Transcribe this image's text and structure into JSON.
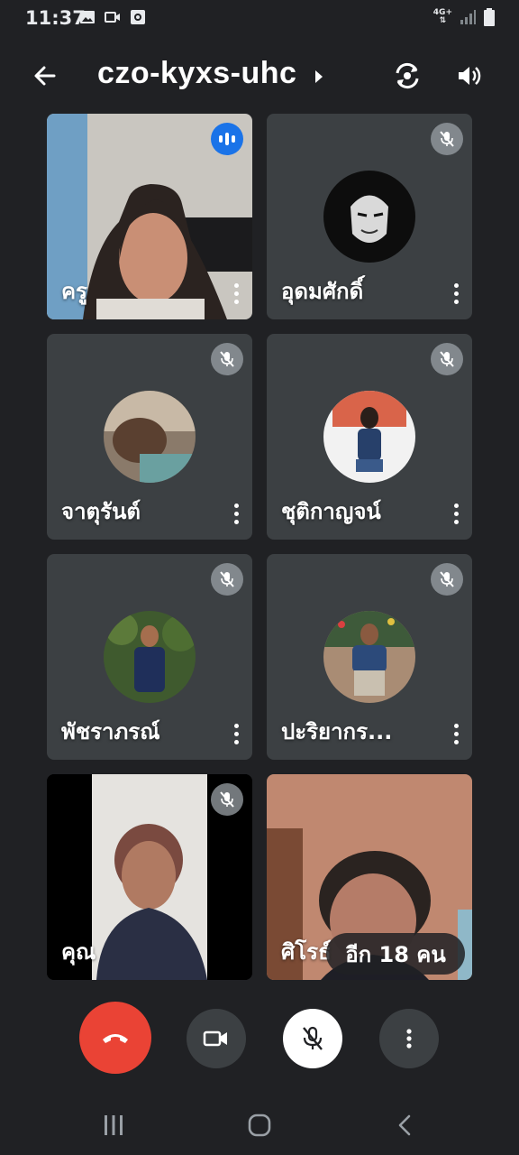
{
  "status_bar": {
    "time": "11:37",
    "network": "4G+",
    "icons": [
      "gallery-icon",
      "video-icon",
      "record-icon",
      "signal-icon",
      "battery-icon"
    ]
  },
  "header": {
    "meeting_code": "czo-kyxs-uhc",
    "icons": [
      "back-arrow-icon",
      "switch-camera-icon",
      "speaker-icon"
    ]
  },
  "participants": [
    {
      "name": "ครู",
      "muted": false,
      "speaking": true,
      "video": true
    },
    {
      "name": "อุดมศักดิ์",
      "muted": true,
      "speaking": false,
      "video": false
    },
    {
      "name": "จาตุรันต์",
      "muted": true,
      "speaking": false,
      "video": false
    },
    {
      "name": "ชุติกาญจน์",
      "muted": true,
      "speaking": false,
      "video": false
    },
    {
      "name": "พัชราภรณ์",
      "muted": true,
      "speaking": false,
      "video": false
    },
    {
      "name": "ปะริยากร...",
      "muted": true,
      "speaking": false,
      "video": false
    },
    {
      "name": "คุณ",
      "muted": true,
      "speaking": false,
      "video": true
    },
    {
      "name": "ศิโรธ์",
      "muted": false,
      "speaking": false,
      "video": true
    }
  ],
  "more_participants_label": "อีก 18 คน",
  "controls": {
    "icons": [
      "end-call-icon",
      "camera-icon",
      "mic-off-icon",
      "more-vertical-icon"
    ],
    "colors": {
      "end_call": "#ea4335",
      "control_bg": "#3c4043",
      "mic_bg": "#ffffff"
    }
  },
  "nav_bar": {
    "icons": [
      "recents-icon",
      "home-icon",
      "back-icon"
    ]
  },
  "colors": {
    "background": "#202124",
    "tile": "#3c4043",
    "speaking": "#1a73e8"
  }
}
